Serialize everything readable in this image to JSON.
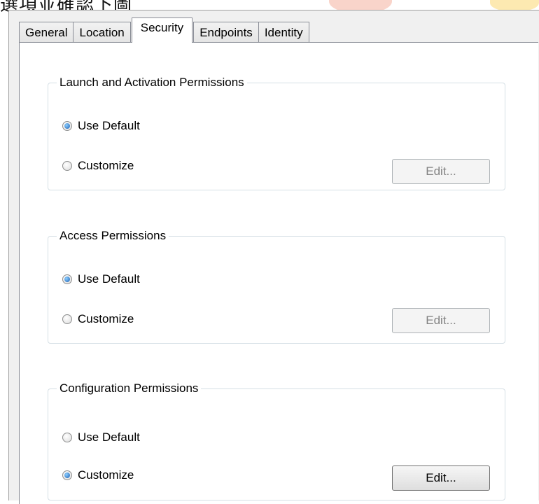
{
  "header": {
    "cropped_text": "選項並確認下圖"
  },
  "tabs": [
    {
      "label": "General",
      "active": false
    },
    {
      "label": "Location",
      "active": false
    },
    {
      "label": "Security",
      "active": true
    },
    {
      "label": "Endpoints",
      "active": false
    },
    {
      "label": "Identity",
      "active": false
    }
  ],
  "groups": [
    {
      "title": "Launch and Activation Permissions",
      "use_default_label": "Use Default",
      "customize_label": "Customize",
      "selected": "Use Default",
      "edit_label": "Edit...",
      "edit_enabled": false
    },
    {
      "title": "Access Permissions",
      "use_default_label": "Use Default",
      "customize_label": "Customize",
      "selected": "Use Default",
      "edit_label": "Edit...",
      "edit_enabled": false
    },
    {
      "title": "Configuration Permissions",
      "use_default_label": "Use Default",
      "customize_label": "Customize",
      "selected": "Customize",
      "edit_label": "Edit...",
      "edit_enabled": true
    }
  ]
}
